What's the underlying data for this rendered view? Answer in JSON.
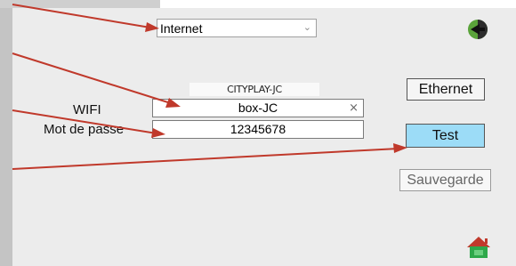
{
  "connection_select": {
    "value": "Internet"
  },
  "wifi_panel": {
    "ssid_header": "CITYPLAY-JC",
    "wifi_label": "WIFI",
    "wifi_value": "box-JC",
    "password_label": "Mot de passe",
    "password_value": "12345678"
  },
  "buttons": {
    "ethernet": "Ethernet",
    "test": "Test",
    "save": "Sauvegarde"
  },
  "icons": {
    "back": "back-arrow-icon",
    "home": "home-icon",
    "clear": "close-icon",
    "dropdown": "chevron-down-icon"
  },
  "colors": {
    "panel_bg": "#ececec",
    "test_active": "#9cdcf7",
    "annotation_arrow": "#c0392b",
    "home_icon": "#2ea84a"
  }
}
